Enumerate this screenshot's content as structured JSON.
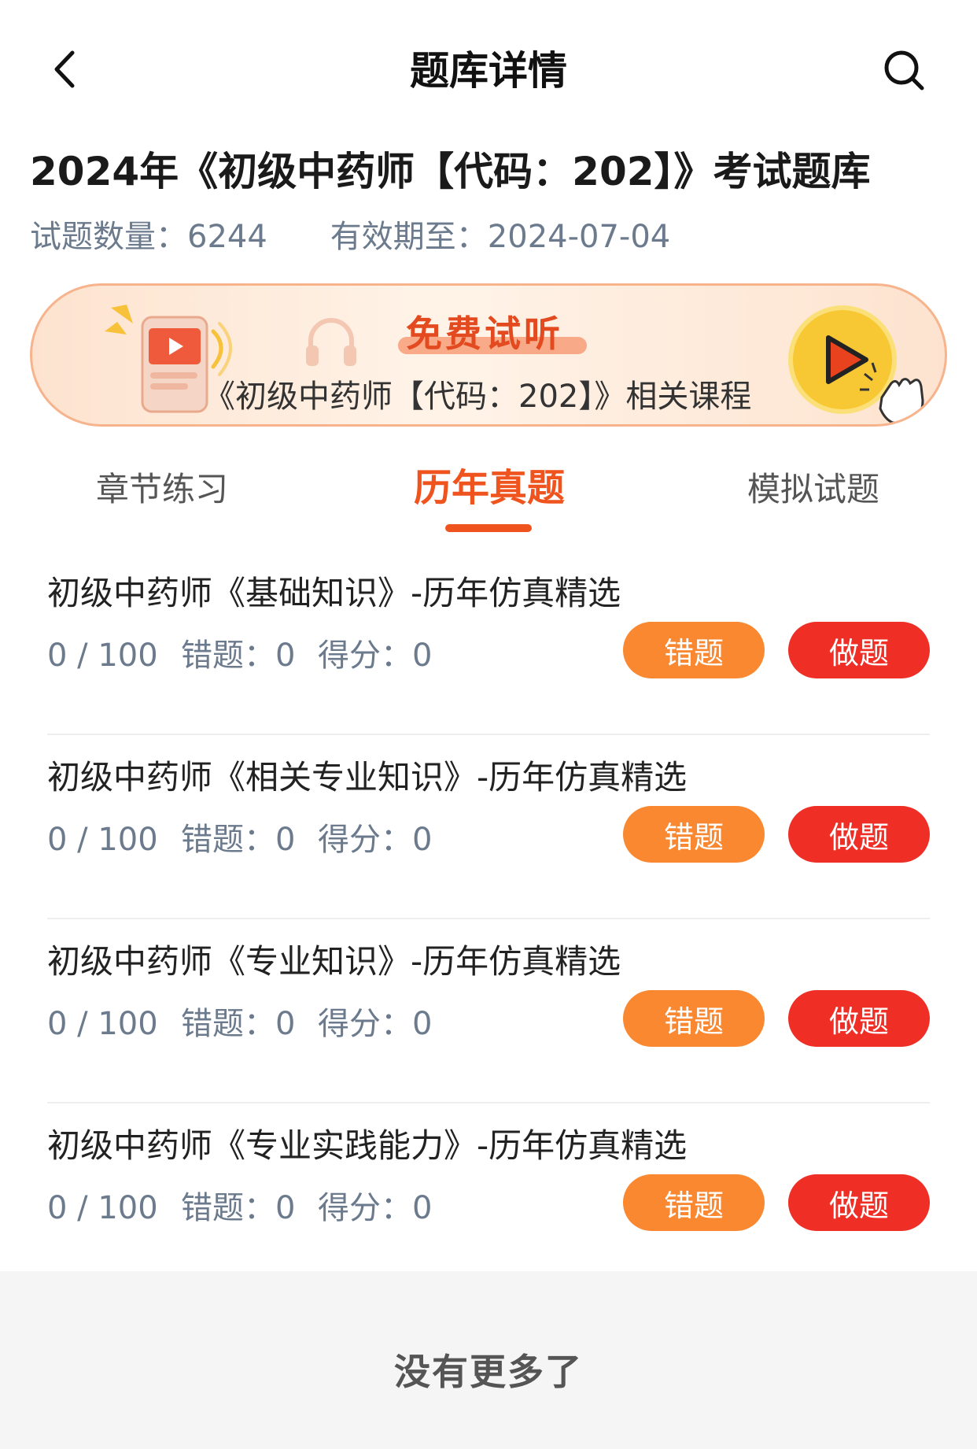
{
  "header": {
    "title": "题库详情"
  },
  "bank": {
    "title": "2024年《初级中药师【代码：202】》考试题库",
    "question_count_label": "试题数量：",
    "question_count": "6244",
    "valid_until_label": "有效期至：",
    "valid_until": "2024-07-04"
  },
  "banner": {
    "free_label": "免费试听",
    "course_text": "《初级中药师【代码：202】》相关课程"
  },
  "tabs": [
    {
      "label": "章节练习",
      "active": false
    },
    {
      "label": "历年真题",
      "active": true
    },
    {
      "label": "模拟试题",
      "active": false
    }
  ],
  "items": [
    {
      "title": "初级中药师《基础知识》-历年仿真精选",
      "progress": "0 / 100",
      "wrong_label": "错题：",
      "wrong_count": "0",
      "score_label": "得分：",
      "score": "0",
      "wrong_button": "错题",
      "do_button": "做题"
    },
    {
      "title": "初级中药师《相关专业知识》-历年仿真精选",
      "progress": "0 / 100",
      "wrong_label": "错题：",
      "wrong_count": "0",
      "score_label": "得分：",
      "score": "0",
      "wrong_button": "错题",
      "do_button": "做题"
    },
    {
      "title": "初级中药师《专业知识》-历年仿真精选",
      "progress": "0 / 100",
      "wrong_label": "错题：",
      "wrong_count": "0",
      "score_label": "得分：",
      "score": "0",
      "wrong_button": "错题",
      "do_button": "做题"
    },
    {
      "title": "初级中药师《专业实践能力》-历年仿真精选",
      "progress": "0 / 100",
      "wrong_label": "错题：",
      "wrong_count": "0",
      "score_label": "得分：",
      "score": "0",
      "wrong_button": "错题",
      "do_button": "做题"
    }
  ],
  "footer": {
    "text": "没有更多了"
  },
  "colors": {
    "accent": "#f0541e",
    "wrong_button": "#f98830",
    "do_button": "#ef2f26"
  },
  "icons": {
    "back": "chevron-left-icon",
    "search": "search-icon",
    "play": "play-icon",
    "headphone": "headphone-icon"
  }
}
